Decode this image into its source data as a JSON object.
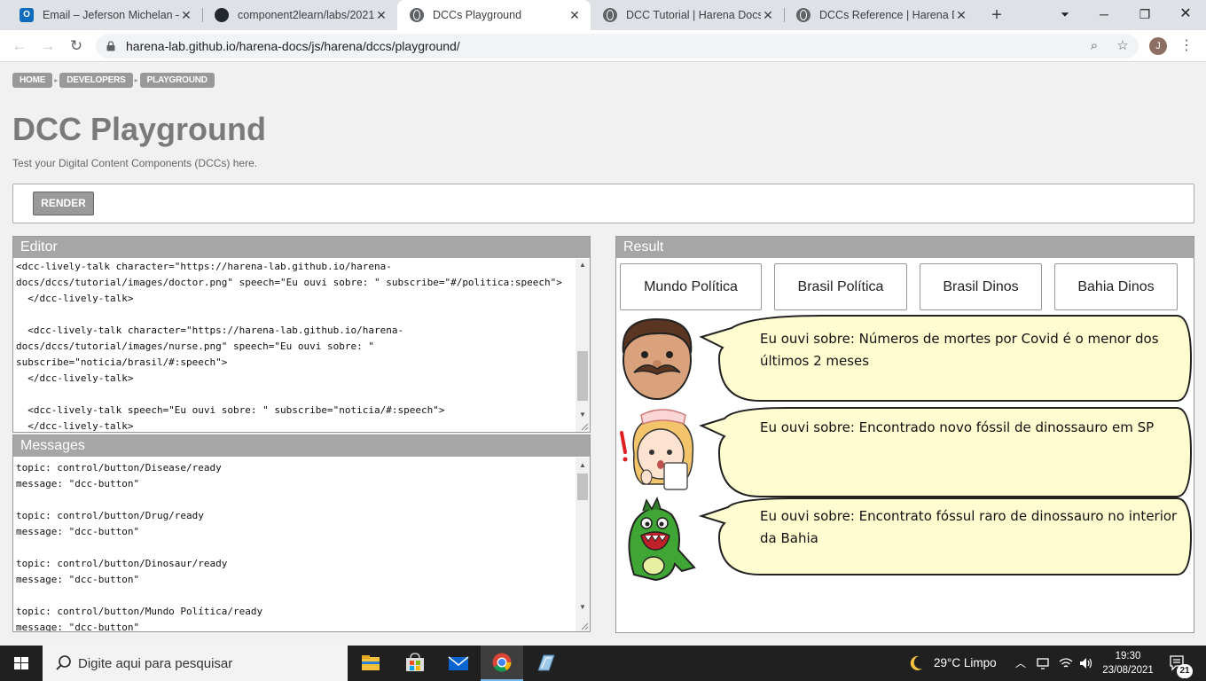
{
  "browser": {
    "tabs": [
      {
        "title": "Email – Jeferson Michelan – Outlook",
        "icon": "outlook-icon",
        "active": false
      },
      {
        "title": "component2learn/labs/2021/",
        "icon": "github-icon",
        "active": false
      },
      {
        "title": "DCCs Playground",
        "icon": "globe-icon",
        "active": true
      },
      {
        "title": "DCC Tutorial | Harena Docs",
        "icon": "globe-icon",
        "active": false
      },
      {
        "title": "DCCs Reference | Harena Docs",
        "icon": "globe-icon",
        "active": false
      }
    ],
    "outlook_glyph": "O",
    "url": "harena-lab.github.io/harena-docs/js/harena/dccs/playground/",
    "profile_initial": "J"
  },
  "page": {
    "breadcrumb": [
      "HOME",
      "DEVELOPERS",
      "PLAYGROUND"
    ],
    "title": "DCC Playground",
    "subtitle": "Test your Digital Content Components (DCCs) here.",
    "render_label": "RENDER",
    "editor": {
      "title": "Editor",
      "lines": [
        "<dcc-lively-talk character=\"https://harena-lab.github.io/harena-",
        "docs/dccs/tutorial/images/doctor.png\" speech=\"Eu ouvi sobre: \" subscribe=\"#/politica:speech\">",
        "  </dcc-lively-talk>",
        "",
        "  <dcc-lively-talk character=\"https://harena-lab.github.io/harena-",
        "docs/dccs/tutorial/images/nurse.png\" speech=\"Eu ouvi sobre: \"",
        "subscribe=\"noticia/brasil/#:speech\">",
        "  </dcc-lively-talk>",
        "",
        "  <dcc-lively-talk speech=\"Eu ouvi sobre: \" subscribe=\"noticia/#:speech\">",
        "  </dcc-lively-talk>"
      ]
    },
    "messages": {
      "title": "Messages",
      "lines": [
        "topic: control/button/Disease/ready",
        "message: \"dcc-button\"",
        "",
        "topic: control/button/Drug/ready",
        "message: \"dcc-button\"",
        "",
        "topic: control/button/Dinosaur/ready",
        "message: \"dcc-button\"",
        "",
        "topic: control/button/Mundo Política/ready",
        "message: \"dcc-button\""
      ]
    },
    "result": {
      "title": "Result",
      "buttons": [
        "Mundo Política",
        "Brasil Política",
        "Brasil Dinos",
        "Bahia Dinos"
      ],
      "talks": [
        {
          "character": "doctor-character",
          "speech": "Eu ouvi sobre: Números de mortes por Covid é o menor dos últimos 2 meses"
        },
        {
          "character": "nurse-character",
          "speech": "Eu ouvi sobre: Encontrado novo fóssil de dinossauro em SP"
        },
        {
          "character": "dinosaur-character",
          "speech": "Eu ouvi sobre: Encontrato fóssul raro de dinossauro no interior da Bahia"
        }
      ]
    }
  },
  "taskbar": {
    "search_placeholder": "Digite aqui para pesquisar",
    "apps": [
      "file-explorer-icon",
      "store-icon",
      "mail-icon",
      "chrome-icon",
      "notepad-icon"
    ],
    "weather": "29°C  Limpo",
    "time": "19:30",
    "date": "23/08/2021",
    "notification_count": "21"
  },
  "colors": {
    "panel_header": "#a6a6a6",
    "crumb_bg": "#999999",
    "title_color": "#7a7a7a",
    "bubble_fill": "#fffdd0"
  }
}
